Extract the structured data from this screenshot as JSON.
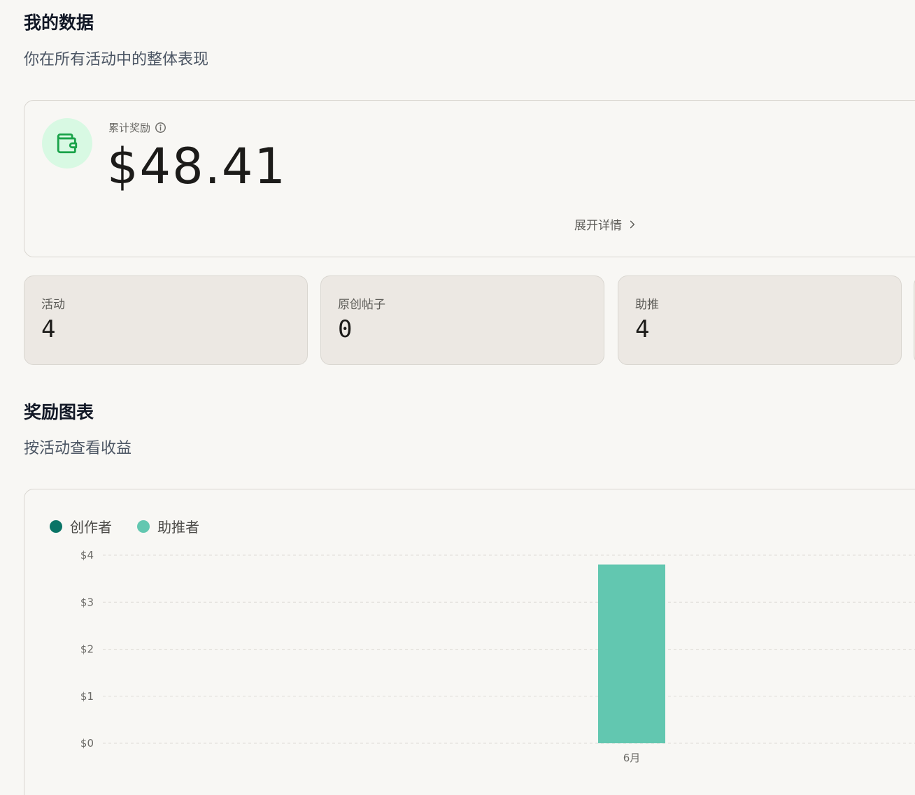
{
  "summary": {
    "title": "我的数据",
    "subtitle": "你在所有活动中的整体表现"
  },
  "reward": {
    "label": "累计奖励",
    "value": "$48.41",
    "expand_label": "展开详情",
    "icon": "wallet-icon",
    "icon_color": "#1aa34a",
    "icon_bg": "#d8f9e3"
  },
  "stats": [
    {
      "label": "活动",
      "value": "4"
    },
    {
      "label": "原创帖子",
      "value": "0"
    },
    {
      "label": "助推",
      "value": "4"
    }
  ],
  "rewards_chart": {
    "title": "奖励图表",
    "subtitle": "按活动查看收益"
  },
  "colors": {
    "creator": "#0a7466",
    "booster": "#62c7b0"
  },
  "chart_data": {
    "type": "bar",
    "stacked": true,
    "categories": [
      "6月"
    ],
    "series": [
      {
        "name": "创作者",
        "values": [
          0
        ]
      },
      {
        "name": "助推者",
        "values": [
          3.8
        ]
      }
    ],
    "yticks": [
      "$4",
      "$3",
      "$2",
      "$1",
      "$0"
    ],
    "ylim": [
      0,
      4
    ],
    "grid": true,
    "legend": "top-left",
    "xlabel": "",
    "ylabel": "",
    "title": ""
  }
}
